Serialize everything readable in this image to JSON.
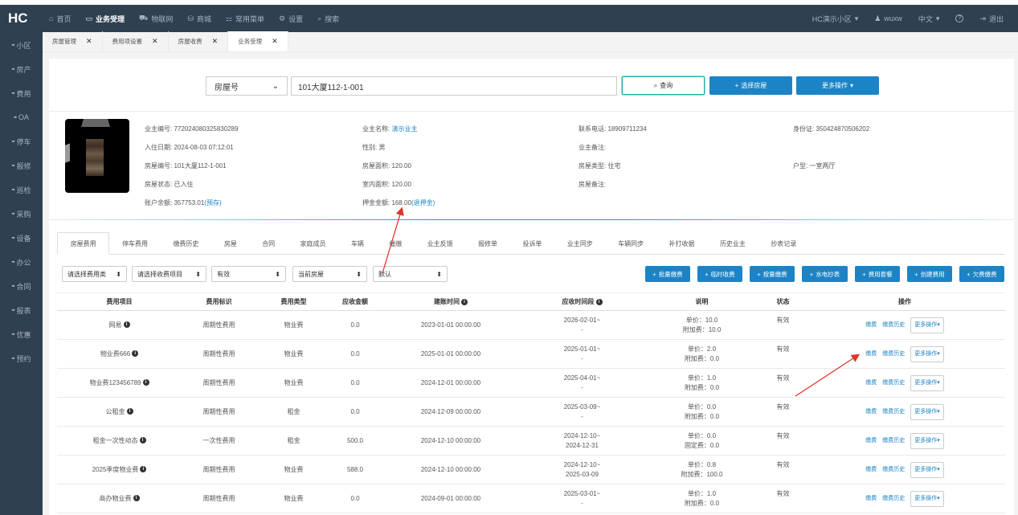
{
  "topbar": {
    "logo": "HC",
    "nav": [
      {
        "icon": "home-icon",
        "glyph": "⌂",
        "label": "首页"
      },
      {
        "icon": "desktop-icon",
        "glyph": "▭",
        "label": "业务受理"
      },
      {
        "icon": "car-icon",
        "glyph": "⛟",
        "label": "物联网"
      },
      {
        "icon": "cart-icon",
        "glyph": "⛁",
        "label": "商城"
      },
      {
        "icon": "sitemap-icon",
        "glyph": "⚏",
        "label": "常用菜单"
      },
      {
        "icon": "gear-icon",
        "glyph": "⚙",
        "label": "设置"
      },
      {
        "icon": "search-icon",
        "glyph": "⌕",
        "label": "搜索"
      }
    ],
    "community": "HC演示小区",
    "user": "wuxw",
    "language": "中文",
    "help": "?",
    "logout": "退出"
  },
  "sidebar": {
    "items": [
      "小区",
      "房产",
      "费用",
      "OA",
      "停车",
      "报修",
      "巡检",
      "采购",
      "设备",
      "办公",
      "合同",
      "报表",
      "优惠",
      "预约"
    ]
  },
  "page_tabs": [
    {
      "label": "房屋管理",
      "close": "✕"
    },
    {
      "label": "费用项设置",
      "close": "✕"
    },
    {
      "label": "房屋收费",
      "close": "✕"
    },
    {
      "label": "业务受理",
      "close": "✕"
    }
  ],
  "search": {
    "type_value": "房屋号",
    "type_caret": "⌄",
    "input_value": "101大厦112-1-001",
    "query_label": "查询",
    "select_house_label": "选择房屋",
    "more_label": "更多操作"
  },
  "owner": {
    "owner_no_label": "业主编号:",
    "owner_no": "772024080325830289",
    "checkin_label": "入住日期:",
    "checkin": "2024-08-03 07:12:01",
    "room_no_label": "房屋编号:",
    "room_no": "101大厦112-1-001",
    "room_status_label": "房屋状态:",
    "room_status": "已入住",
    "balance_label": "账户余额:",
    "balance": "357753.01",
    "balance_link": "(预存)",
    "name_label": "业主名称:",
    "name": "演示业主",
    "gender_label": "性别:",
    "gender": "男",
    "area_label": "房屋面积:",
    "area": "120.00",
    "inner_area_label": "室内面积:",
    "inner_area": "120.00",
    "deposit_label": "押金金额:",
    "deposit": "168.00",
    "deposit_link": "(退押金)",
    "phone_label": "联系电话:",
    "phone": "18909711234",
    "owner_remark_label": "业主备注:",
    "owner_remark": "",
    "room_type_label": "房屋类型:",
    "room_type": "住宅",
    "room_remark_label": "房屋备注:",
    "room_remark": "",
    "id_label": "身份证:",
    "id": "350424870506202",
    "layout_label": "户型:",
    "layout": "一室两厅"
  },
  "subtabs": [
    "房屋费用",
    "停车费用",
    "缴费历史",
    "房屋",
    "合同",
    "家庭成员",
    "车辆",
    "催缴",
    "业主反馈",
    "报修单",
    "投诉单",
    "业主同步",
    "车辆同步",
    "补打收据",
    "历史业主",
    "抄表记录"
  ],
  "filters": {
    "fee_type": "请选择费用类",
    "fee_item": "请选择收费项目",
    "state": "有效",
    "room": "当前房屋",
    "default": "默认",
    "caret": "⬍"
  },
  "actions": [
    "批量缴费",
    "临时收费",
    "按量缴费",
    "水电抄表",
    "费用套餐",
    "创建费用",
    "欠费缴费"
  ],
  "table": {
    "headers": [
      "费用项目",
      "费用标识",
      "费用类型",
      "应收金额",
      "建账时间",
      "应收时间段",
      "说明",
      "状态",
      "操作"
    ],
    "info_glyph": "i",
    "rows": [
      {
        "name": "网易",
        "flag": "周期性费用",
        "type": "物业费",
        "amount": "0.0",
        "created": "2023-01-01 00:00:00",
        "period1": "2026-02-01~",
        "period2": "-",
        "desc1": "单价：10.0",
        "desc2": "附加费：10.0",
        "status": "有效"
      },
      {
        "name": "物业费666",
        "flag": "周期性费用",
        "type": "物业费",
        "amount": "0.0",
        "created": "2025-01-01 00:00:00",
        "period1": "2025-01-01~",
        "period2": "-",
        "desc1": "单价：2.0",
        "desc2": "附加费：0.0",
        "status": "有效"
      },
      {
        "name": "物业费123456789",
        "flag": "周期性费用",
        "type": "物业费",
        "amount": "0.0",
        "created": "2024-12-01 00:00:00",
        "period1": "2025-04-01~",
        "period2": "-",
        "desc1": "单价：1.0",
        "desc2": "附加费：0.0",
        "status": "有效"
      },
      {
        "name": "公租金",
        "flag": "周期性费用",
        "type": "租金",
        "amount": "0.0",
        "created": "2024-12-09 00:00:00",
        "period1": "2025-03-09~",
        "period2": "-",
        "desc1": "单价：0.0",
        "desc2": "附加费：0.0",
        "status": "有效"
      },
      {
        "name": "租金一次性动态",
        "flag": "一次性费用",
        "type": "租金",
        "amount": "500.0",
        "created": "2024-12-10 00:00:00",
        "period1": "2024-12-10~",
        "period2": "2024-12-31",
        "desc1": "单价：0.0",
        "desc2": "固定费：0.0",
        "status": "有效"
      },
      {
        "name": "2025季度物业费",
        "flag": "周期性费用",
        "type": "物业费",
        "amount": "588.0",
        "created": "2024-12-10 00:00:00",
        "period1": "2024-12-10~",
        "period2": "2025-03-09",
        "desc1": "单价：0.8",
        "desc2": "附加费：100.0",
        "status": "有效"
      },
      {
        "name": "商办物业费",
        "flag": "周期性费用",
        "type": "物业费",
        "amount": "0.0",
        "created": "2024-09-01 00:00:00",
        "period1": "2025-03-01~",
        "period2": "-",
        "desc1": "单价：1.0",
        "desc2": "附加费：0.0",
        "status": "有效"
      }
    ],
    "op_pay": "缴费",
    "op_history": "缴费历史",
    "op_more": "更多操作"
  },
  "colors": {
    "nav_bg": "#2f4050",
    "primary_blue": "#1c84c6",
    "arrow_red": "#e0352b"
  }
}
